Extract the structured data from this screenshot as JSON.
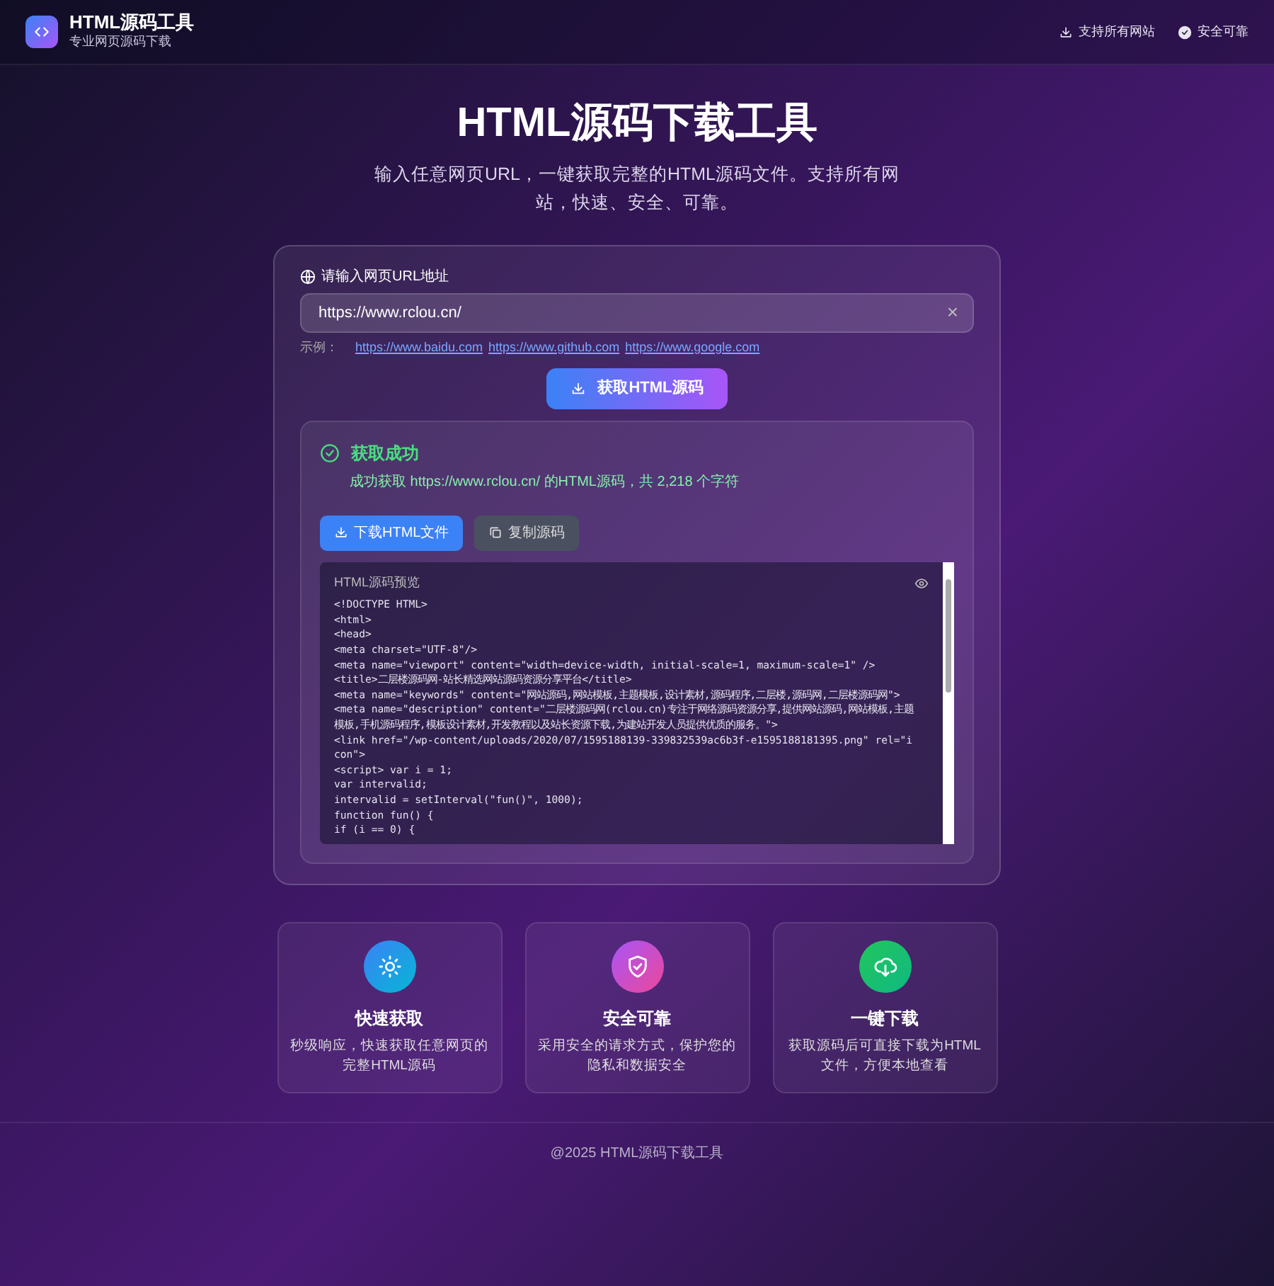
{
  "header": {
    "logo_title": "HTML源码工具",
    "logo_subtitle": "专业网页源码下载",
    "badges": [
      {
        "kind": "download",
        "label": "支持所有网站"
      },
      {
        "kind": "check",
        "label": "安全可靠"
      }
    ]
  },
  "hero": {
    "title": "HTML源码下载工具",
    "subtitle": "输入任意网页URL，一键获取完整的HTML源码文件。支持所有网站，快速、安全、可靠。"
  },
  "form": {
    "label": "请输入网页URL地址",
    "url_value": "https://www.rclou.cn/",
    "clear": "×",
    "examples_label": "示例：",
    "examples": [
      "https://www.baidu.com",
      "https://www.github.com",
      "https://www.google.com"
    ],
    "submit": "获取HTML源码"
  },
  "result": {
    "title": "获取成功",
    "message": "成功获取 https://www.rclou.cn/ 的HTML源码，共 2,218 个字符",
    "buttons": [
      {
        "kind": "download",
        "label": "下载HTML文件"
      },
      {
        "kind": "copy",
        "label": "复制源码"
      }
    ],
    "preview_title": "HTML源码预览",
    "code_lines": [
      "<!DOCTYPE HTML>",
      "<html>",
      "<head>",
      "<meta charset=\"UTF-8\"/>",
      "<meta name=\"viewport\" content=\"width=device-width, initial-scale=1, maximum-scale=1\" />",
      "<title>二层楼源码网-站长精选网站源码资源分享平台</title>",
      "<meta name=\"keywords\" content=\"网站源码,网站模板,主题模板,设计素材,源码程序,二层楼,源码网,二层楼源码网\">",
      "<meta name=\"description\" content=\"二层楼源码网(rclou.cn)专注于网络源码资源分享,提供网站源码,网站模板,主题模板,手机源码程序,模板设计素材,开发教程以及站长资源下载,为建站开发人员提供优质的服务。\">",
      "<link href=\"/wp-content/uploads/2020/07/1595188139-339832539ac6b3f-e1595188181395.png\" rel=\"icon\">",
      "<script> var i = 1;",
      "var intervalid;",
      "intervalid = setInterval(\"fun()\", 1000);",
      "function fun() {",
      "if (i == 0) {"
    ]
  },
  "features": [
    {
      "kind": "speed",
      "title": "快速获取",
      "text": "秒级响应，快速获取任意网页的完整HTML源码"
    },
    {
      "kind": "secure",
      "title": "安全可靠",
      "text": "采用安全的请求方式，保护您的隐私和数据安全"
    },
    {
      "kind": "download",
      "title": "一键下载",
      "text": "获取源码后可直接下载为HTML文件，方便本地查看"
    }
  ],
  "footer": "@2025 HTML源码下载工具"
}
